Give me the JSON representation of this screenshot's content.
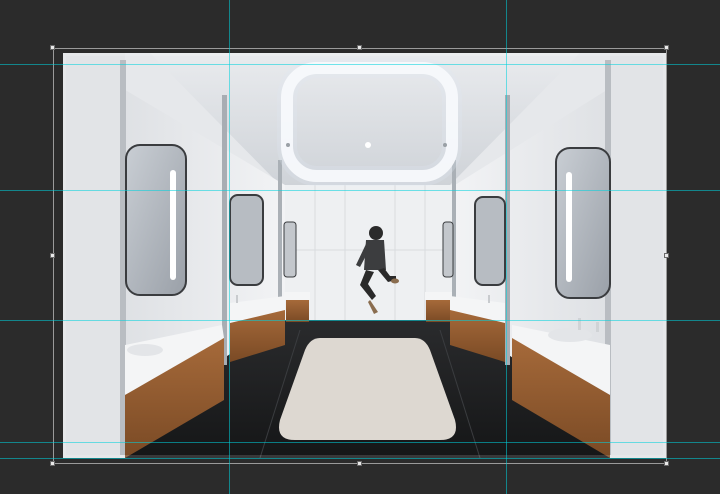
{
  "app": {
    "background": "#2b2b2b",
    "guide_color": "#00d2dc"
  },
  "document": {
    "subject": "bathroom-interior-photo"
  },
  "transform": {
    "handle_count": 8
  },
  "guides": {
    "horizontal_count": 5,
    "vertical_count": 2
  }
}
